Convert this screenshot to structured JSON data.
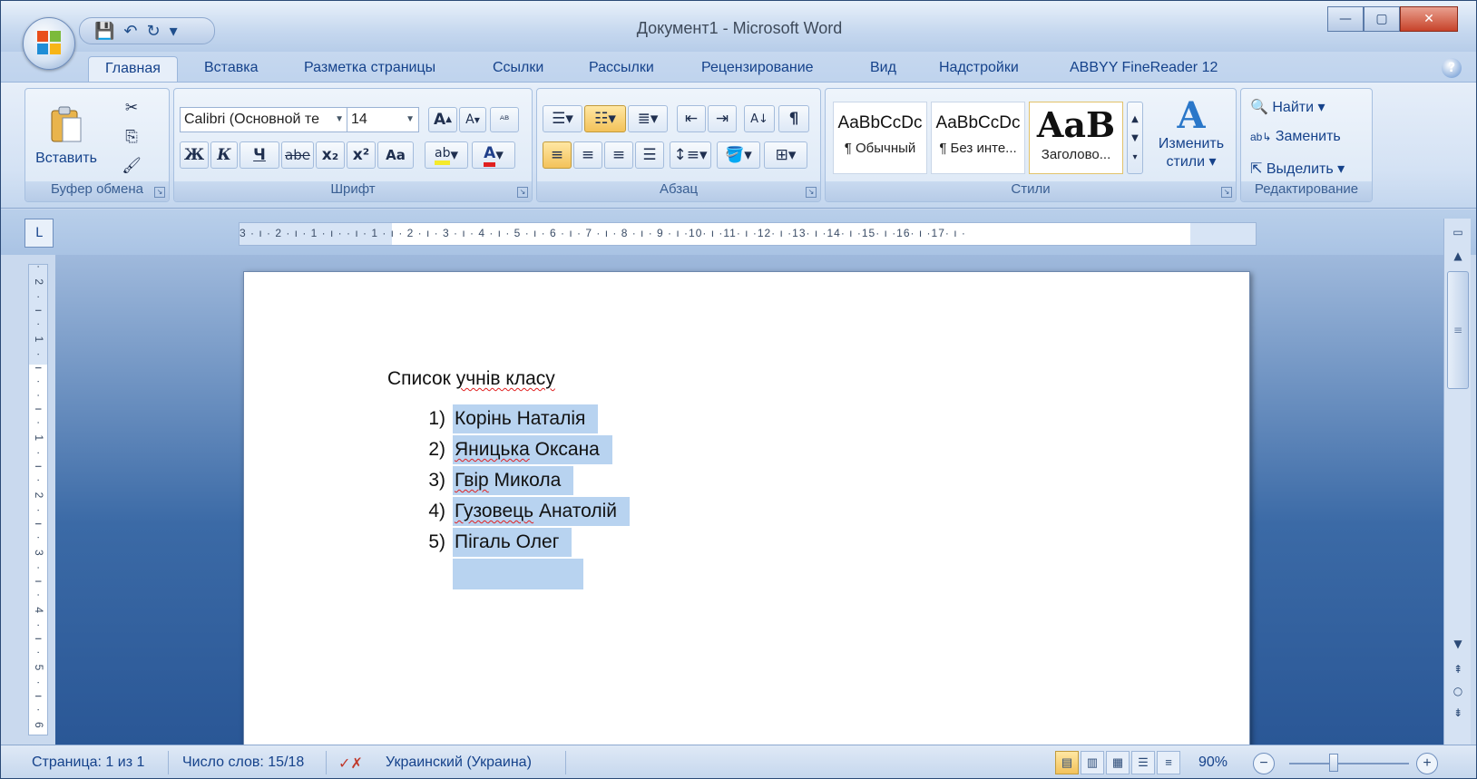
{
  "window": {
    "title": "Документ1 - Microsoft Word",
    "minimize_glyph": "—",
    "maximize_glyph": "▢",
    "close_glyph": "✕"
  },
  "qat": {
    "save_icon": "💾",
    "undo_icon": "↶",
    "redo_icon": "↻",
    "customize_icon": "▾"
  },
  "tabs": [
    {
      "label": "Главная",
      "active": true
    },
    {
      "label": "Вставка"
    },
    {
      "label": "Разметка страницы"
    },
    {
      "label": "Ссылки"
    },
    {
      "label": "Рассылки"
    },
    {
      "label": "Рецензирование"
    },
    {
      "label": "Вид"
    },
    {
      "label": "Надстройки"
    },
    {
      "label": "ABBYY FineReader 12"
    }
  ],
  "help_glyph": "?",
  "ribbon": {
    "clipboard": {
      "label": "Буфер обмена",
      "paste_label": "Вставить"
    },
    "font": {
      "label": "Шрифт",
      "font_name": "Calibri (Основной те",
      "font_size": "14",
      "bold": "Ж",
      "italic": "К",
      "underline": "Ч",
      "strike": "abe",
      "subscript": "x₂",
      "superscript": "x²",
      "case": "Aa",
      "grow": "A",
      "shrink": "A"
    },
    "paragraph": {
      "label": "Абзац",
      "pilcrow": "¶",
      "sort": "А↓"
    },
    "styles": {
      "label": "Стили",
      "items": [
        {
          "sample": "AaBbCcDc",
          "name": "¶ Обычный"
        },
        {
          "sample": "AaBbCcDc",
          "name": "¶ Без инте..."
        },
        {
          "sample": "AaB",
          "name": "Заголово..."
        }
      ],
      "change_styles": "Изменить",
      "change_styles_2": "стили"
    },
    "editing": {
      "label": "Редактирование",
      "find": "Найти",
      "replace": "Заменить",
      "select": "Выделить"
    }
  },
  "ruler": {
    "corner": "L",
    "h_ticks": "3 · ı · 2 · ı · 1 · ı ·      · ı · 1 · ı · 2 · ı · 3 · ı · 4 · ı · 5 · ı · 6 · ı · 7 · ı · 8 · ı · 9 · ı ·10· ı ·11· ı ·12· ı ·13· ı ·14· ı ·15· ı ·16· ı ·17· ı ·",
    "v_ticks": "· 2 · ı · 1 · ı ·   · ı · 1 · ı · 2 · ı · 3 · ı · 4 · ı · 5 · ı · 6 · ı · 7 ·"
  },
  "document": {
    "heading_plain": "Список ",
    "heading_underlined": "учнів класу",
    "items": [
      {
        "num": "1)",
        "text": "Корінь Наталія",
        "misspelled": ""
      },
      {
        "num": "2)",
        "text": " Оксана",
        "misspelled": "Яницька"
      },
      {
        "num": "3)",
        "text": " Микола",
        "misspelled": "Гвір"
      },
      {
        "num": "4)",
        "text": " Анатолій",
        "misspelled": "Гузовець"
      },
      {
        "num": "5)",
        "text": "Пігаль Олег",
        "misspelled": ""
      }
    ]
  },
  "status": {
    "page": "Страница: 1 из 1",
    "words": "Число слов: 15/18",
    "language": "Украинский (Украина)",
    "zoom": "90%"
  }
}
